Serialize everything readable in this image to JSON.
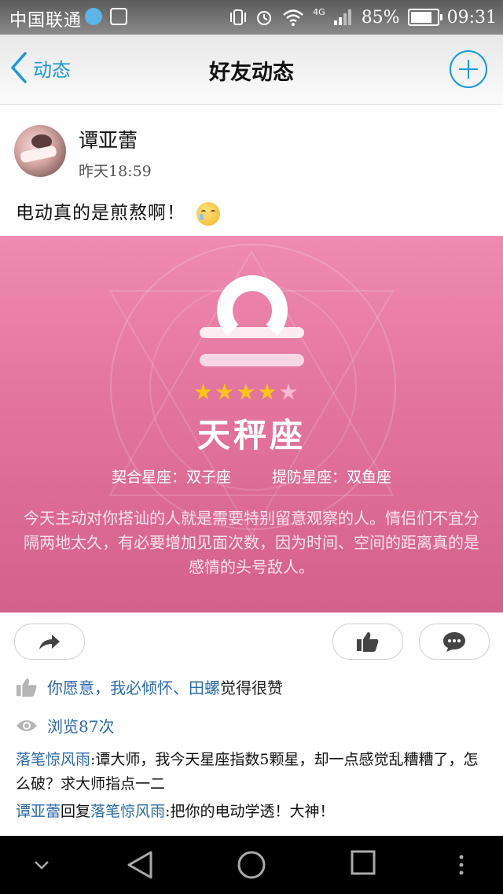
{
  "status_bar": {
    "carrier": "中国联通",
    "network": "4G",
    "battery": "85%",
    "time": "09:31"
  },
  "nav": {
    "back_label": "动态",
    "title": "好友动态"
  },
  "post": {
    "author": "谭亚蕾",
    "time": "昨天18:59",
    "text": "电动真的是煎熬啊！"
  },
  "horoscope": {
    "stars_on": 4,
    "stars_total": 5,
    "sign": "天秤座",
    "match_label": "契合星座：双子座",
    "beware_label": "提防星座：双鱼座",
    "fortune": "今天主动对你搭讪的人就是需要特别留意观察的人。情侣们不宜分隔两地太久，有必要增加见面次数，因为时间、空间的距离真的是感情的头号敌人。"
  },
  "likes": {
    "names": "你愿意，我必倾怀、田螺",
    "suffix": "觉得很赞"
  },
  "views": "浏览87次",
  "comments": [
    {
      "author": "落笔惊风雨",
      "sep": ":",
      "text": "谭大师，我今天星座指数5颗星，却一点感觉乱糟糟了，怎么破？求大师指点一二"
    },
    {
      "author": "谭亚蕾",
      "mid": "回复",
      "target": "落笔惊风雨",
      "sep": ":",
      "text": "把你的电动学透！大神！"
    }
  ],
  "colors": {
    "accent_blue": "#1a9ad6",
    "link_blue": "#2b6aa7",
    "horoscope_pink": "#e3769f",
    "star_gold": "#ffc21a"
  }
}
